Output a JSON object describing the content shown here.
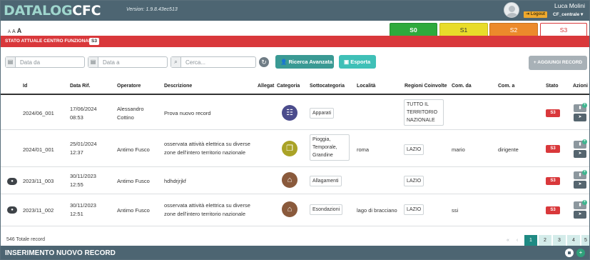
{
  "app": {
    "logo_a": "DATALOG",
    "logo_b": "CFC",
    "version": "Version: 1.9.8.43ec513",
    "user_name": "Luca Molini",
    "logout_label": "Logout",
    "profile_label": "CF_centrale ▾"
  },
  "font_size": {
    "small": "A",
    "medium": "A",
    "large": "A"
  },
  "states": {
    "tabs": [
      {
        "label": "S0",
        "color": "#2eaa3c"
      },
      {
        "label": "S1",
        "color": "#e8dc2a"
      },
      {
        "label": "S2",
        "color": "#ec8a2b"
      },
      {
        "label": "S3",
        "color": "#d9383b"
      }
    ],
    "current_label": "STATO ATTUALE CENTRO FUNZIONALE",
    "current_badge": "S3"
  },
  "filters": {
    "date_from_placeholder": "Data da",
    "date_to_placeholder": "Data a",
    "search_placeholder": "Cerca...",
    "advanced_search_label": "Ricerca Avanzata",
    "export_label": "Esporta",
    "add_record_label": "+ AGGIUNGI RECORD"
  },
  "table": {
    "columns": {
      "id": "Id",
      "data_rif": "Data Rif.",
      "operatore": "Operatore",
      "descrizione": "Descrizione",
      "allegati": "Allegat",
      "categoria": "Categoria",
      "sottocategoria": "Sottocategoria",
      "localita": "Località",
      "regioni": "Regioni Coinvolte",
      "com_da": "Com. da",
      "com_a": "Com. a",
      "stato": "Stato",
      "azioni": "Azioni"
    },
    "rows": [
      {
        "id": "2024/06_001",
        "date": "17/06/2024",
        "time": "08:53",
        "op1": "Alessandro",
        "op2": "Cottino",
        "desc1": "Prova nuovo record",
        "desc2": "",
        "category_icon": "network-icon",
        "category_color": "#4b4c8c",
        "sub": [
          "Apparati"
        ],
        "localita": "",
        "regioni": [
          "TUTTO IL",
          "TERRITORIO",
          "NAZIONALE"
        ],
        "com_da": "",
        "com_a": "",
        "stato": "S3"
      },
      {
        "id": "2024/01_001",
        "date": "25/01/2024",
        "time": "12:37",
        "op1": "Antimo Fusco",
        "op2": "",
        "desc1": "osservata attività elettrica su diverse",
        "desc2": "zone dell'intero territorio nazionale",
        "category_icon": "clipboard-icon",
        "category_color": "#aaa327",
        "sub": [
          "Pioggia,",
          "Temporale,",
          "Grandine"
        ],
        "localita": "roma",
        "regioni": [
          "LAZIO"
        ],
        "com_da": "mario",
        "com_a": "dirigente",
        "stato": "S3"
      },
      {
        "id": "2023/11_003",
        "date": "30/11/2023",
        "time": "12:55",
        "op1": "Antimo Fusco",
        "op2": "",
        "desc1": "hdhdrjrjkf",
        "desc2": "",
        "category_icon": "house-icon",
        "category_color": "#8a5a3c",
        "sub": [
          "Allagamenti"
        ],
        "localita": "",
        "regioni": [
          "LAZIO"
        ],
        "com_da": "",
        "com_a": "",
        "stato": "S3"
      },
      {
        "id": "2023/11_002",
        "date": "30/11/2023",
        "time": "12:51",
        "op1": "Antimo Fusco",
        "op2": "",
        "desc1": "osservata attività elettrica su diverse",
        "desc2": "zone dell'intero territorio nazionale",
        "category_icon": "house-icon",
        "category_color": "#8a5a3c",
        "sub": [
          "Esondazioni"
        ],
        "localita": "lago di bracciano",
        "regioni": [
          "LAZIO"
        ],
        "com_da": "ssi",
        "com_a": "",
        "stato": "S3"
      }
    ]
  },
  "footer": {
    "total": "546 Totale record",
    "pages": [
      "«",
      "‹",
      "1",
      "2",
      "3",
      "4",
      "5"
    ],
    "bottom_title": "INSERIMENTO NUOVO RECORD"
  }
}
